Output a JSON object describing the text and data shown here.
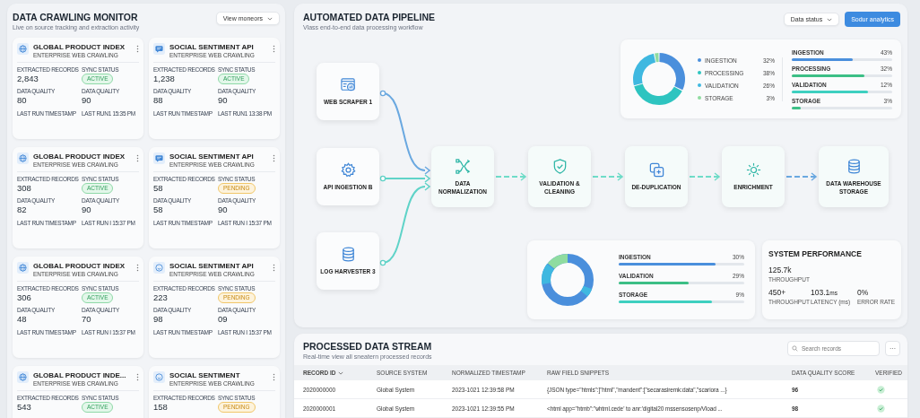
{
  "monitor": {
    "title": "DATA CRAWLING MONITOR",
    "subtitle": "Live on source tracking and extraction activity",
    "dropdown": "View moneors",
    "cards": [
      {
        "title": "GLOBAL PRODUCT INDEX",
        "subtitle": "ENTERPRISE WEB CRAWLING",
        "kind": "globe",
        "fields": [
          {
            "label": "EXTRACTED RECORDS",
            "value": "2,843",
            "kind": "number"
          },
          {
            "label": "SYNC STATUS",
            "value": "ACTIVE",
            "kind": "status",
            "active": true
          },
          {
            "label": "DATA QUALITY",
            "value": "80",
            "kind": "number"
          },
          {
            "label": "DATA QUALITY",
            "value": "90",
            "kind": "number"
          }
        ],
        "footer": [
          "LAST RUN TIMESTAMP",
          "LAST RUN1 15:35 PM"
        ]
      },
      {
        "title": "SOCIAL SENTIMENT API",
        "subtitle": "ENTERPRISE WEB CRAWLING",
        "kind": "chat",
        "fields": [
          {
            "label": "EXTRACTED RECORDS",
            "value": "1,238",
            "kind": "number"
          },
          {
            "label": "SYNC STATUS",
            "value": "ACTIVE",
            "kind": "status",
            "active": true
          },
          {
            "label": "DATA QUALITY",
            "value": "88",
            "kind": "number"
          },
          {
            "label": "DATA QUALITY",
            "value": "90",
            "kind": "number"
          }
        ],
        "footer": [
          "LAST RUN TIMESTAMP",
          "LAST RUN1 13:38 PM"
        ]
      },
      {
        "title": "GLOBAL PRODUCT INDEX",
        "subtitle": "ENTERPRISE WEB CRAWLING",
        "kind": "globe",
        "fields": [
          {
            "label": "EXTRACTED RECORDS",
            "value": "308",
            "kind": "number"
          },
          {
            "label": "SYNC STATUS",
            "value": "ACTIVE",
            "kind": "status",
            "active": true
          },
          {
            "label": "DATA QUALITY",
            "value": "82",
            "kind": "number"
          },
          {
            "label": "DATA QUALITY",
            "value": "90",
            "kind": "number"
          }
        ],
        "footer": [
          "LAST RUN TIMESTAMP",
          "LAST RUN I 15:37 PM"
        ]
      },
      {
        "title": "SOCIAL SENTIMENT API",
        "subtitle": "ENTERPRISE WEB CRAWLING",
        "kind": "chat",
        "fields": [
          {
            "label": "EXTRACTED RECORDS",
            "value": "58",
            "kind": "number"
          },
          {
            "label": "SYNC STATUS",
            "value": "PENDING",
            "kind": "status",
            "active": false
          },
          {
            "label": "DATA QUALITY",
            "value": "58",
            "kind": "number"
          },
          {
            "label": "DATA QUALITY",
            "value": "90",
            "kind": "number"
          }
        ],
        "footer": [
          "LAST RUN TIMESTAMP",
          "LAST RUN I 15:37 PM"
        ]
      },
      {
        "title": "GLOBAL PRODUCT INDEX",
        "subtitle": "ENTERPRISE WEB CRAWLING",
        "kind": "globe",
        "fields": [
          {
            "label": "EXTRACTED RECORDS",
            "value": "306",
            "kind": "number"
          },
          {
            "label": "SYNC STATUS",
            "value": "ACTIVE",
            "kind": "status",
            "active": true
          },
          {
            "label": "DATA QUALITY",
            "value": "48",
            "kind": "number"
          },
          {
            "label": "DATA QUALITY",
            "value": "70",
            "kind": "number"
          }
        ],
        "footer": [
          "LAST RUN TIMESTAMP",
          "LAST RUN I 15:37 PM"
        ]
      },
      {
        "title": "SOCIAL SENTIMENT API",
        "subtitle": "ENTERPRISE WEB CRAWLING",
        "kind": "smile",
        "fields": [
          {
            "label": "EXTRACTED RECORDS",
            "value": "223",
            "kind": "number"
          },
          {
            "label": "SYNC STATUS",
            "value": "PENDING",
            "kind": "status",
            "active": false
          },
          {
            "label": "DATA QUALITY",
            "value": "98",
            "kind": "number"
          },
          {
            "label": "DATA QUALITY",
            "value": "09",
            "kind": "number"
          }
        ],
        "footer": [
          "LAST RUN TIMESTAMP",
          "LAST RUN I 15:37 PM"
        ]
      },
      {
        "title": "GLOBAL PRODUCT INDE...",
        "subtitle": "ENTERPRISE WEB CRAWLING",
        "kind": "globe",
        "fields": [
          {
            "label": "EXTRACTED RECORDS",
            "value": "543",
            "kind": "number"
          },
          {
            "label": "SYNC STATUS",
            "value": "ACTIVE",
            "kind": "status",
            "active": true
          }
        ]
      },
      {
        "title": "SOCIAL SENTIMENT",
        "subtitle": "ENTERPRISE WEB CRAWLING",
        "kind": "smile",
        "fields": [
          {
            "label": "EXTRACTED RECORDS",
            "value": "158",
            "kind": "number"
          },
          {
            "label": "SYNC STATUS",
            "value": "PENDING",
            "kind": "status",
            "active": false
          }
        ]
      }
    ]
  },
  "pipeline": {
    "title": "AUTOMATED DATA PIPELINE",
    "subtitle": "Vlass end-to-end data processing workflow",
    "status_dropdown": "Data status",
    "analytics_button": "Sodur analytics",
    "sources": [
      {
        "label": "WEB SCRAPER 1",
        "kind": "browser-chart"
      },
      {
        "label": "API INGESTION B",
        "kind": "gear"
      },
      {
        "label": "LOG HARVESTER 3",
        "kind": "database"
      }
    ],
    "stages": [
      {
        "label": "DATA NORMALIZATION",
        "kind": "split"
      },
      {
        "label": "VALIDATION & CLEANING",
        "kind": "shield"
      },
      {
        "label": "DE-DUPLICATION",
        "kind": "copy"
      },
      {
        "label": "ENRICHMENT",
        "kind": "hub"
      },
      {
        "label": "DATA WAREHOUSE STORAGE",
        "kind": "database"
      }
    ],
    "distribution": {
      "chart_data": {
        "type": "donut",
        "categories": [
          "INGESTION",
          "PROCESSING",
          "VALIDATION",
          "STORAGE"
        ],
        "values": [
          32,
          38,
          26,
          3
        ]
      },
      "legend": [
        {
          "value": "32%",
          "color": "#4a8fdc"
        },
        {
          "value": "38%",
          "color": "#2ec4c0"
        },
        {
          "value": "26%",
          "color": "#3fb8e0"
        },
        {
          "value": "3%",
          "color": "#8fdca0"
        }
      ],
      "bars": [
        {
          "label": "INGESTION",
          "value": "43%",
          "level": 0.61,
          "color": "#4a8fdc"
        },
        {
          "label": "PROCESSING",
          "value": "32%",
          "level": 0.72,
          "color": "#3cbf86"
        },
        {
          "label": "VALIDATION",
          "value": "12%",
          "level": 0.76,
          "color": "#3ed0c0"
        },
        {
          "label": "STORAGE",
          "value": "3%",
          "level": 0.09,
          "color": "#3cbf86"
        }
      ]
    },
    "load": {
      "bars": [
        {
          "label": "INGESTION",
          "value": "30%",
          "level": 0.77,
          "color": "#4a8fdc"
        },
        {
          "label": "VALIDATION",
          "value": "29%",
          "level": 0.56,
          "color": "#3cbf86"
        },
        {
          "label": "STORAGE",
          "value": "9%",
          "level": 0.74,
          "color": "#3ed0c0"
        }
      ]
    },
    "performance": {
      "title": "SYSTEM PERFORMANCE",
      "main": {
        "value": "125.7k",
        "label": "THROUGHPUT"
      },
      "metrics": [
        {
          "value": "450+",
          "label": "THROUGHPUT"
        },
        {
          "value": "103.1",
          "unit": "ms",
          "label": "LATENCY (ms)"
        },
        {
          "value": "0%",
          "label": "ERROR RATE"
        }
      ]
    }
  },
  "stream": {
    "title": "PROCESSED DATA STREAM",
    "subtitle": "Real-time view all sneatern processed records",
    "search": {
      "placeholder": "Search records"
    },
    "more_button": "···",
    "columns": [
      "RECORD ID",
      "SOURCE SYSTEM",
      "NORMALIZED TIMESTAMP",
      "RAW FIELD SNIPPETS",
      "DATA QUALITY SCORE",
      "VERIFIED"
    ],
    "rows": [
      {
        "id": "2020000000",
        "source": "Global System",
        "timestamp": "2023-1021 12:39:58 PM",
        "snippet": "{JSON type=\"htmls\":]\"html\",\"mandent\":[\"secarasiremk:data\",\"scariora ...}",
        "score": "96",
        "verified": true
      },
      {
        "id": "2020000001",
        "source": "Global System",
        "timestamp": "2023-1021 12:39:55 PM",
        "snippet": "<html app=\"htmb\":\"ѡhtml.cede' to anr:'digital20 mssensosenp/Vload ...",
        "score": "98",
        "verified": true
      }
    ]
  }
}
